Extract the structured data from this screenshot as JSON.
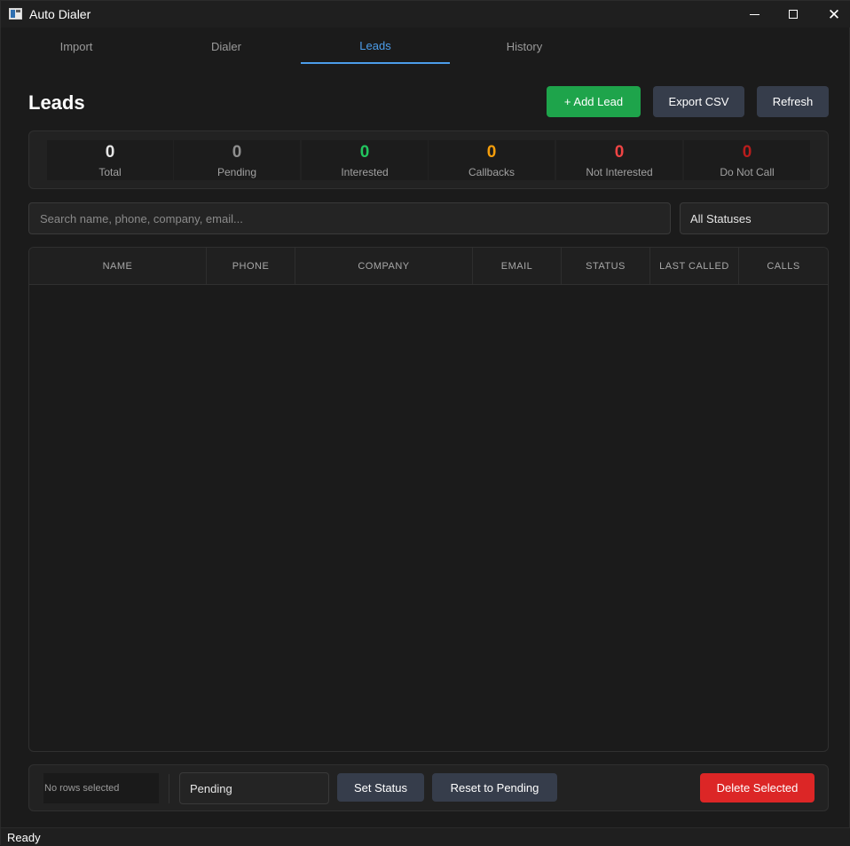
{
  "window": {
    "title": "Auto Dialer"
  },
  "tabs": [
    {
      "label": "Import",
      "active": false
    },
    {
      "label": "Dialer",
      "active": false
    },
    {
      "label": "Leads",
      "active": true
    },
    {
      "label": "History",
      "active": false
    }
  ],
  "header": {
    "title": "Leads",
    "add_label": "+ Add Lead",
    "export_label": "Export CSV",
    "refresh_label": "Refresh"
  },
  "stats": [
    {
      "value": "0",
      "label": "Total",
      "color": "#e6e6e6"
    },
    {
      "value": "0",
      "label": "Pending",
      "color": "#8f8f8f"
    },
    {
      "value": "0",
      "label": "Interested",
      "color": "#22c55e"
    },
    {
      "value": "0",
      "label": "Callbacks",
      "color": "#f59e0b"
    },
    {
      "value": "0",
      "label": "Not Interested",
      "color": "#ef4444"
    },
    {
      "value": "0",
      "label": "Do Not Call",
      "color": "#b91c1c"
    }
  ],
  "search": {
    "placeholder": "Search name, phone, company, email...",
    "value": ""
  },
  "status_filter": {
    "selected": "All Statuses"
  },
  "table": {
    "columns": [
      "NAME",
      "PHONE",
      "COMPANY",
      "EMAIL",
      "STATUS",
      "LAST CALLED",
      "CALLS"
    ],
    "rows": []
  },
  "bottom": {
    "selection_text": "No rows selected",
    "status_choice": "Pending",
    "set_status_label": "Set Status",
    "reset_label": "Reset to Pending",
    "delete_label": "Delete Selected"
  },
  "statusbar": {
    "text": "Ready"
  },
  "colors": {
    "accent": "#4c9dea",
    "add_button": "#1ea44b",
    "delete_button": "#dc2626",
    "secondary_button": "#363d4b"
  }
}
